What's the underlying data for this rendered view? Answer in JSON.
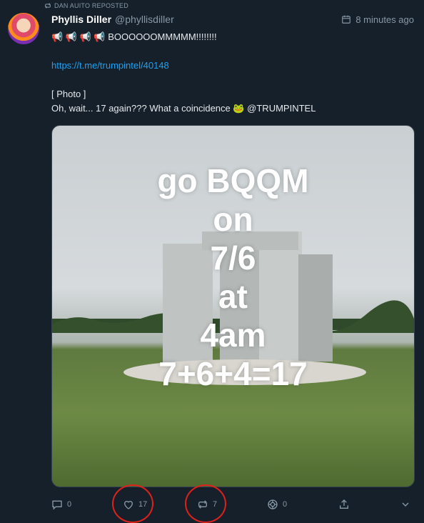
{
  "repost_label": "DAN AUITO REPOSTED",
  "author": {
    "name": "Phyllis Diller",
    "handle": "@phyllisdiller"
  },
  "timestamp": "8 minutes ago",
  "body": {
    "line1": "📢 📢 📢 📢 BOOOOOOMMMMM!!!!!!!!",
    "link": "https://t.me/trumpintel/40148",
    "photo_label": "[ Photo ]",
    "caption": "Oh, wait... 17 again??? What a coincidence 🐸 @TRUMPINTEL"
  },
  "image_text": [
    "go BQQM",
    "on",
    "7/6",
    "at",
    "4am",
    "7+6+4=17"
  ],
  "actions": {
    "replies": "0",
    "likes": "17",
    "reposts": "7",
    "quotes": "0"
  },
  "colors": {
    "background": "#15202b",
    "link": "#1da1f2",
    "muted": "#8899a6",
    "annotation_circle": "#e0211b"
  }
}
